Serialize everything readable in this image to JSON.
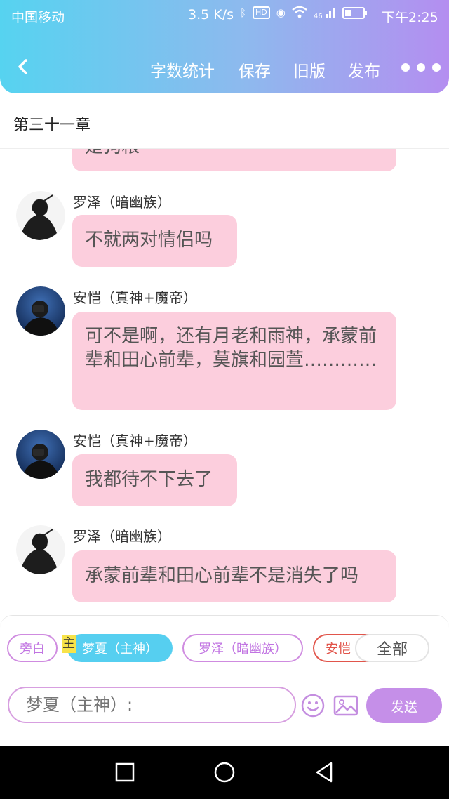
{
  "status": {
    "carrier": "中国移动",
    "speed": "3.5 K/s",
    "hd": "HD",
    "network": "46",
    "time": "下午2:25"
  },
  "nav": {
    "word_count": "字数统计",
    "save": "保存",
    "old_version": "旧版",
    "publish": "发布"
  },
  "chapter": {
    "title": "第三十一章"
  },
  "messages": [
    {
      "name": "",
      "text": "是狗粮"
    },
    {
      "name": "罗泽（暗幽族）",
      "text": "不就两对情侣吗"
    },
    {
      "name": "安恺（真神+魔帝）",
      "text": "可不是啊，还有月老和雨神，承蒙前辈和田心前辈，莫旗和园萱…………"
    },
    {
      "name": "安恺（真神+魔帝）",
      "text": "我都待不下去了"
    },
    {
      "name": "罗泽（暗幽族）",
      "text": "承蒙前辈和田心前辈不是消失了吗"
    }
  ],
  "roles": {
    "narrator": "旁白",
    "main_tag": "主",
    "mengxia": "梦夏（主神）",
    "luoze": "罗泽（暗幽族）",
    "ankai": "安恺",
    "all": "全部"
  },
  "composer": {
    "placeholder": "梦夏（主神）:",
    "send": "发送"
  },
  "colors": {
    "header_gradient_start": "#56d3f0",
    "header_gradient_end": "#b48ef0",
    "bubble": "#fccedd",
    "send_button": "#c58fe8",
    "active_chip": "#56cff0"
  }
}
